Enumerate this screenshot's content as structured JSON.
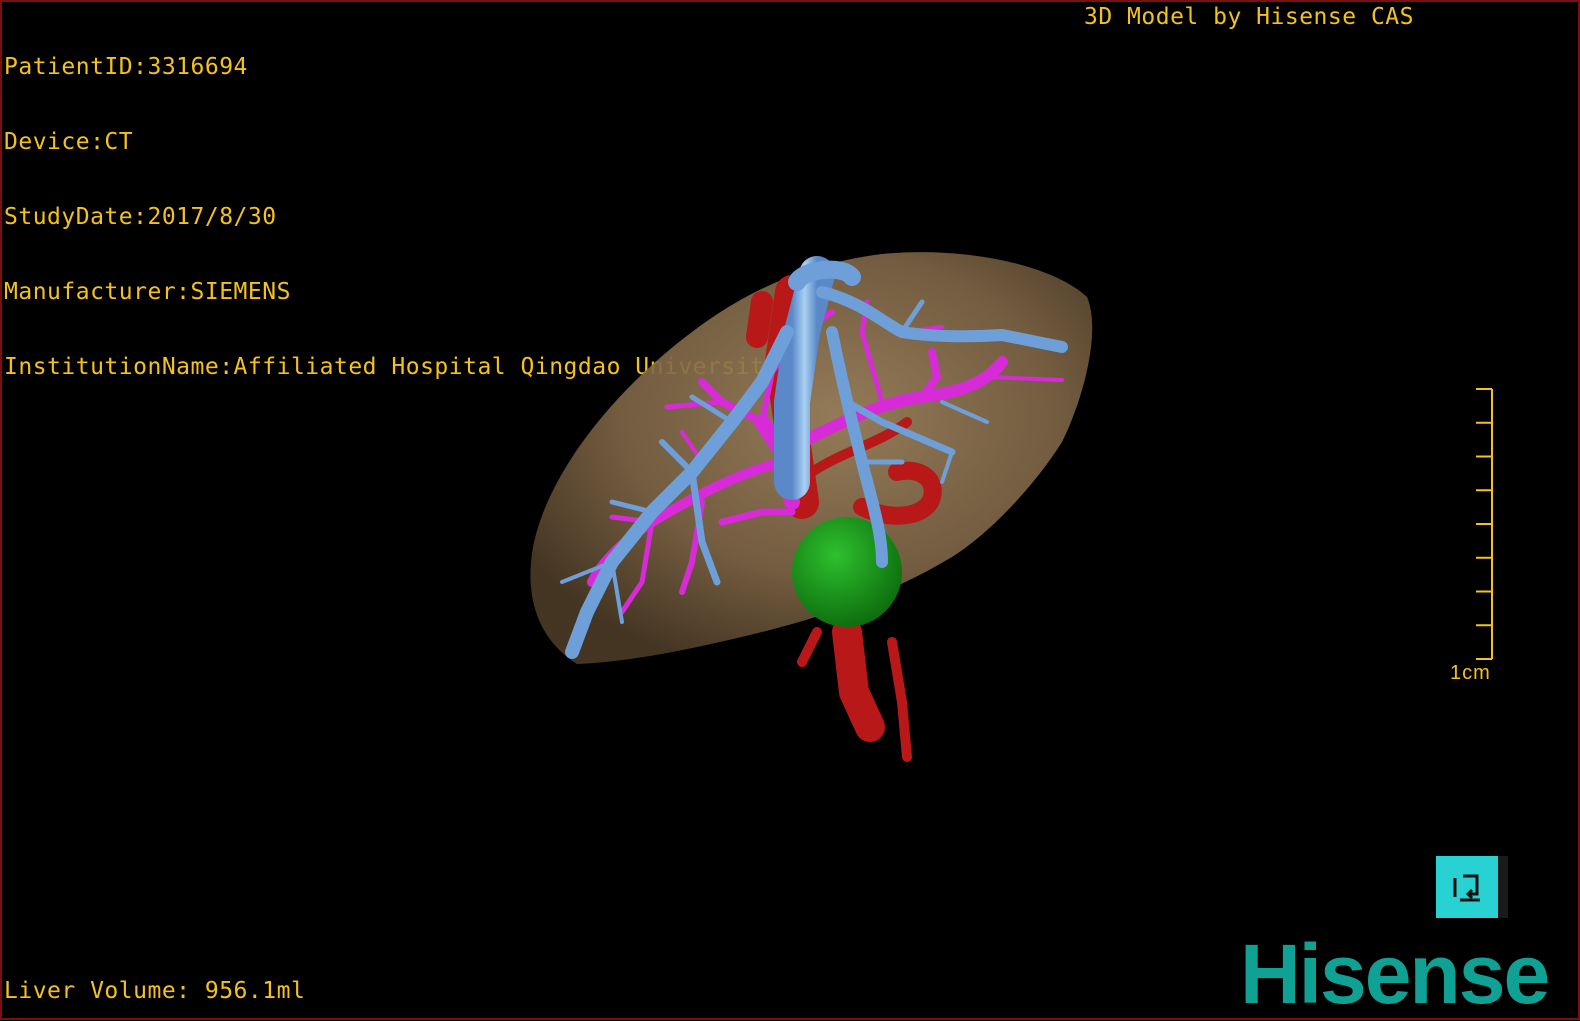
{
  "overlay": {
    "info_lines": [
      "PatientID:3316694",
      "Device:CT",
      "StudyDate:2017/8/30",
      "Manufacturer:SIEMENS",
      "InstitutionName:Affiliated Hospital Qingdao University-C"
    ],
    "credit": "3D Model by Hisense CAS",
    "liver_volume": "Liver Volume: 956.1ml"
  },
  "scale": {
    "label": "1cm",
    "tick_count": 9
  },
  "tool_button": {
    "icon": "reset-view-icon"
  },
  "brand": {
    "logo_text": "Hisense"
  },
  "colors": {
    "overlay_text": "#f4c21c",
    "liver": "#8a6f4d",
    "hepatic_vein": "#6e9fd8",
    "portal_vein": "#d82bd8",
    "artery": "#b81818",
    "gallbladder": "#18a018",
    "brand": "#0fa294",
    "tool_button": "#28d2d2"
  }
}
